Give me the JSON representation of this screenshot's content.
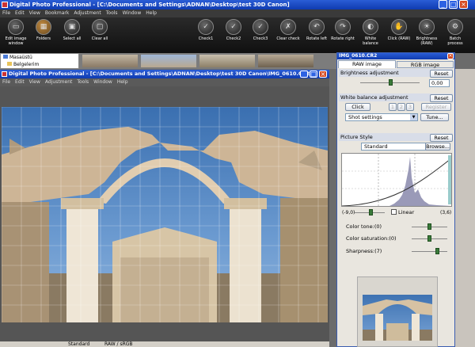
{
  "app": {
    "title": "Digital Photo Professional - [C:\\Documents and Settings\\ADNAN\\Desktop\\test 30D Canon]"
  },
  "menu": [
    "File",
    "Edit",
    "View",
    "Bookmark",
    "Adjustment",
    "Tools",
    "Window",
    "Help"
  ],
  "toolbar": [
    {
      "label": "Edit image window",
      "icon": "edit-window-icon"
    },
    {
      "label": "Folders",
      "icon": "folders-icon"
    },
    {
      "label": "Select all",
      "icon": "select-all-icon"
    },
    {
      "label": "Clear all",
      "icon": "clear-all-icon"
    },
    {
      "label": "Check1",
      "icon": "check1-icon"
    },
    {
      "label": "Check2",
      "icon": "check2-icon"
    },
    {
      "label": "Check3",
      "icon": "check3-icon"
    },
    {
      "label": "Clear check",
      "icon": "clear-check-icon"
    },
    {
      "label": "Rotate left",
      "icon": "rotate-left-icon"
    },
    {
      "label": "Rotate right",
      "icon": "rotate-right-icon"
    },
    {
      "label": "White balance",
      "icon": "white-balance-icon"
    },
    {
      "label": "Click (RAW)",
      "icon": "click-raw-icon"
    },
    {
      "label": "Brightness (RAW)",
      "icon": "brightness-raw-icon"
    },
    {
      "label": "Batch process",
      "icon": "batch-process-icon"
    }
  ],
  "folder_tree": [
    "Masaüstü",
    "Belgelerim"
  ],
  "image_window": {
    "title": "Digital Photo Professional - [C:\\Documents and Settings\\ADNAN\\Desktop\\test 30D Canon\\IMG_0610.CR2]",
    "menu": [
      "File",
      "Edit",
      "View",
      "Adjustment",
      "Tools",
      "Window",
      "Help"
    ]
  },
  "status": {
    "style": "Standard",
    "mode": "RAW / sRGB"
  },
  "palette": {
    "title": "IMG_0610.CR2",
    "tabs": [
      "RAW image adjustment",
      "RGB image adjustment"
    ],
    "brightness": {
      "label": "Brightness adjustment",
      "reset": "Reset",
      "value": "0,00",
      "level": 0.5
    },
    "white_balance": {
      "label": "White balance adjustment",
      "reset": "Reset",
      "click": "Click",
      "presets": [
        "1",
        "2",
        "3"
      ],
      "register": "Register",
      "setting": "Shot settings",
      "tune": "Tune..."
    },
    "picture_style": {
      "label": "Picture Style",
      "reset": "Reset",
      "style": "Standard",
      "browse": "Browse..."
    },
    "curve": {
      "min": "(-9,0)",
      "max": "(3,6)",
      "linear": "Linear"
    },
    "color_tone": {
      "label": "Color tone:(0)",
      "level": 0.5
    },
    "color_saturation": {
      "label": "Color saturation:(0)",
      "level": 0.5
    },
    "sharpness": {
      "label": "Sharpness:(7)",
      "level": 0.7
    }
  }
}
